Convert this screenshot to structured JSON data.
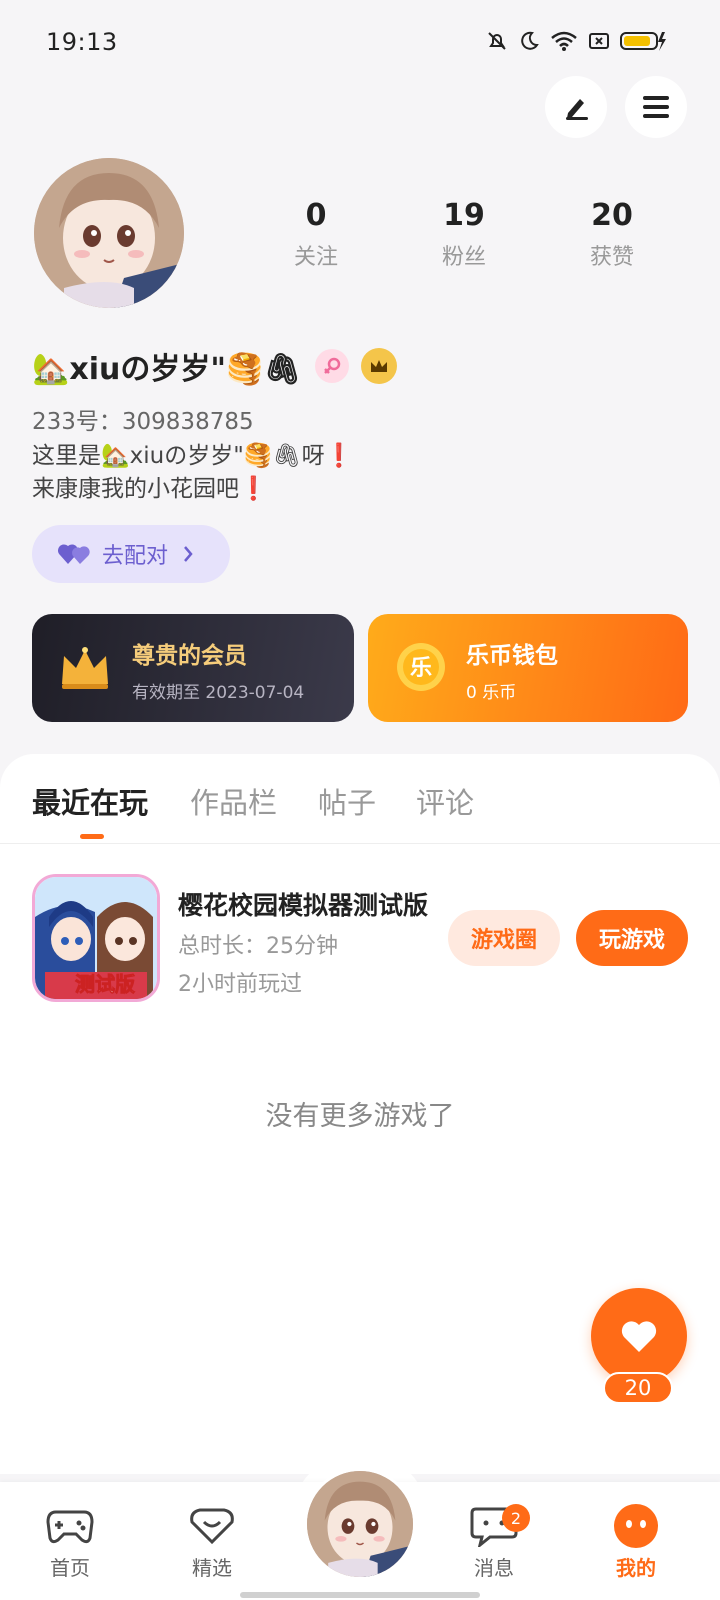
{
  "status_bar": {
    "time": "19:13"
  },
  "profile": {
    "stats": [
      {
        "value": "0",
        "label": "关注"
      },
      {
        "value": "19",
        "label": "粉丝"
      },
      {
        "value": "20",
        "label": "获赞"
      }
    ],
    "name": "🏡xiuの岁岁\"🥞🖇",
    "uid": "233号：309838785",
    "bio": "这里是🏡xiuの岁岁\"🥞🖇呀❗\n来康康我的小花园吧❗",
    "match_label": "去配对"
  },
  "cards": {
    "vip": {
      "title": "尊贵的会员",
      "subtitle": "有效期至 2023-07-04"
    },
    "wallet": {
      "title": "乐币钱包",
      "subtitle": "0 乐币",
      "coin_char": "乐"
    }
  },
  "tabs": [
    "最近在玩",
    "作品栏",
    "帖子",
    "评论"
  ],
  "recent_game": {
    "title": "樱花校园模拟器测试版",
    "playtime": "总时长：25分钟",
    "last_played": "2小时前玩过",
    "badge": "测试版",
    "circle_button": "游戏圈",
    "play_button": "玩游戏"
  },
  "empty_text": "没有更多游戏了",
  "like": {
    "count": "20"
  },
  "bottom_nav": {
    "home": "首页",
    "featured": "精选",
    "messages": "消息",
    "messages_badge": "2",
    "mine": "我的"
  },
  "colors": {
    "accent": "#ff6b17",
    "vip_gold": "#f6cd7b",
    "match_purple": "#6c5fcf"
  },
  "icons": [
    "edit-icon",
    "menu-icon",
    "heart-icon",
    "crown-icon",
    "coin-icon",
    "gamepad-icon",
    "chat-icon"
  ]
}
